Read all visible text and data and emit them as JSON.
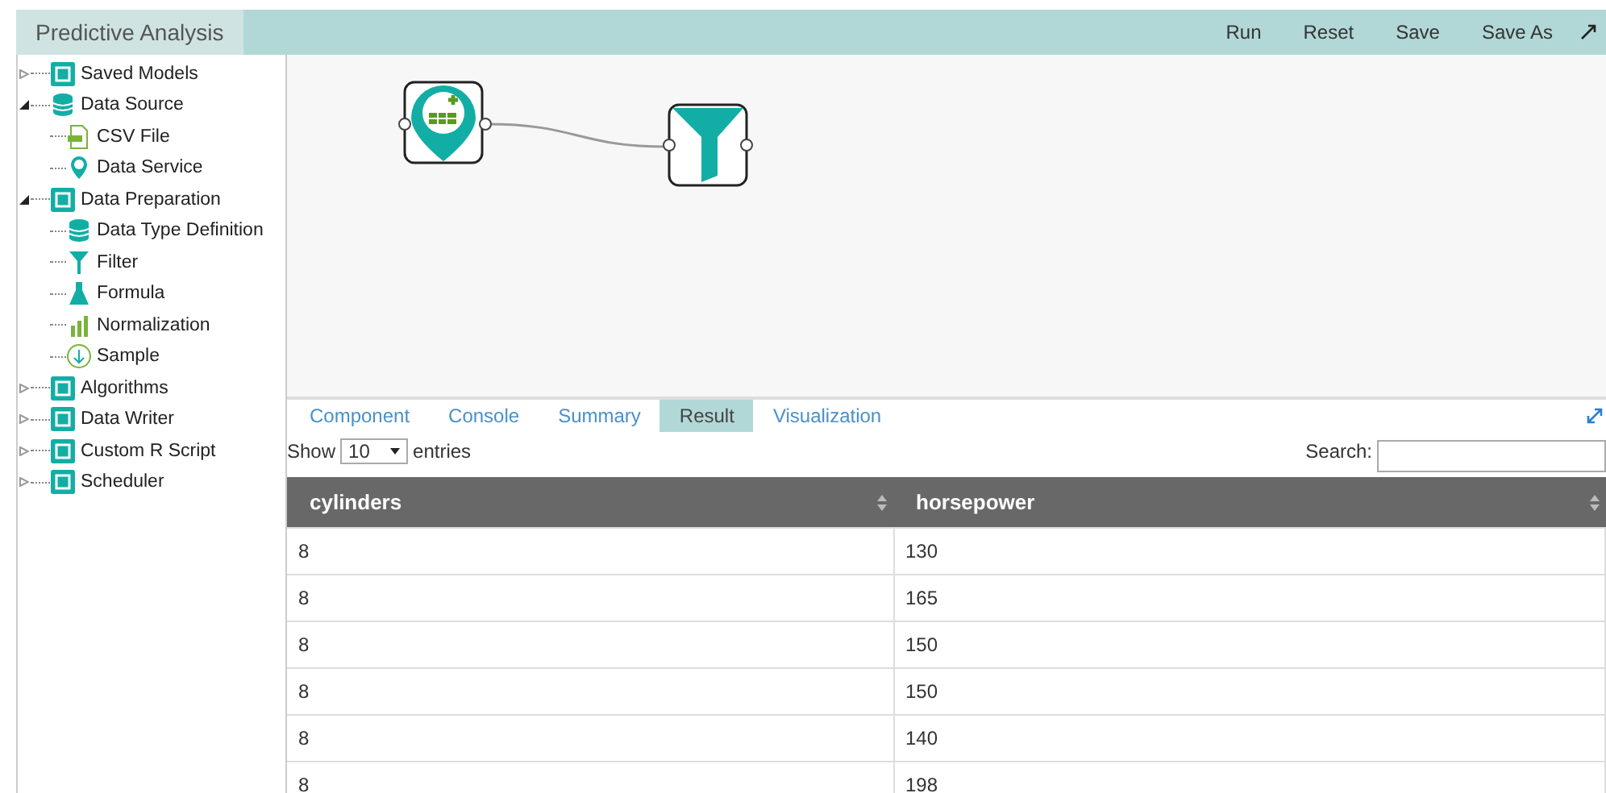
{
  "app_title": "Predictive Analysis",
  "toolbar": [
    "Run",
    "Reset",
    "Save",
    "Save As"
  ],
  "tree": [
    {
      "label": "Saved Models",
      "expanded": false
    },
    {
      "label": "Data Source",
      "expanded": true,
      "children": [
        {
          "label": "CSV File"
        },
        {
          "label": "Data Service"
        }
      ]
    },
    {
      "label": "Data Preparation",
      "expanded": true,
      "children": [
        {
          "label": "Data Type Definition"
        },
        {
          "label": "Filter"
        },
        {
          "label": "Formula"
        },
        {
          "label": "Normalization"
        },
        {
          "label": "Sample"
        }
      ]
    },
    {
      "label": "Algorithms",
      "expanded": false
    },
    {
      "label": "Data Writer",
      "expanded": false
    },
    {
      "label": "Custom R Script",
      "expanded": false
    },
    {
      "label": "Scheduler",
      "expanded": false
    }
  ],
  "tabs": [
    {
      "label": "Component",
      "selected": false
    },
    {
      "label": "Console",
      "selected": false
    },
    {
      "label": "Summary",
      "selected": false
    },
    {
      "label": "Result",
      "selected": true
    },
    {
      "label": "Visualization",
      "selected": false
    }
  ],
  "length_menu": {
    "show": "Show",
    "value": "10",
    "entries": "entries"
  },
  "search": {
    "label": "Search:"
  },
  "table": {
    "columns": [
      "cylinders",
      "horsepower"
    ],
    "rows": [
      [
        "8",
        "130"
      ],
      [
        "8",
        "165"
      ],
      [
        "8",
        "150"
      ],
      [
        "8",
        "150"
      ],
      [
        "8",
        "140"
      ],
      [
        "8",
        "198"
      ]
    ]
  }
}
